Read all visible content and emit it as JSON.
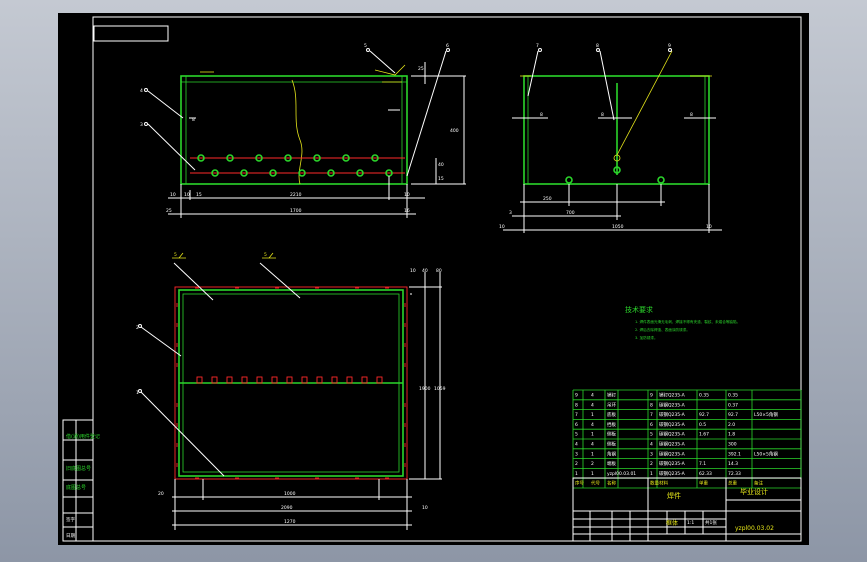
{
  "drawing": {
    "front_view": {
      "dims": {
        "d1": "10",
        "d2": "10",
        "d3": "15",
        "d4": "25",
        "d5": "2210",
        "d6": "1700",
        "d7": "10",
        "d8": "16",
        "d9": "40",
        "d10": "15",
        "d11": "25",
        "d12": "400",
        "d13": "8"
      },
      "balloons": [
        "4",
        "3",
        "5",
        "6"
      ]
    },
    "side_view": {
      "dims": {
        "a": "8",
        "b": "8",
        "c": "8",
        "d": "250",
        "e": "700",
        "f": "3",
        "g": "10",
        "h": "1050",
        "i": "10"
      },
      "balloons": [
        "7",
        "8",
        "9"
      ]
    },
    "top_view": {
      "dims": {
        "a": "20",
        "b": "1000",
        "c": "2090",
        "d": "1270",
        "e": "10",
        "f": "40",
        "g": "1900",
        "h": "1059",
        "i": "10",
        "j": "80"
      },
      "weld_marks": [
        "5",
        "5"
      ],
      "balloons": [
        "2",
        "1"
      ]
    },
    "tech_requirements": {
      "title": "技术要求",
      "lines": [
        "1. 焊件表面光滑无毛刺、焊接不得有夹渣、裂纹、未熔合等缺陷。",
        "2. 焊后去除焊渣、表面涂防锈漆。",
        "3. 加防锈漆。"
      ]
    },
    "parts_table": {
      "rows": [
        [
          "9",
          "4",
          "销钉",
          "9",
          "销钉Q235-A",
          "0.35",
          "0.35",
          ""
        ],
        [
          "8",
          "4",
          "吊环",
          "8",
          "碳钢Q235-A",
          "",
          "0.37",
          ""
        ],
        [
          "7",
          "1",
          "底板",
          "7",
          "碳钢Q235-A",
          "92.7",
          "92.7",
          "L50×5角钢"
        ],
        [
          "6",
          "4",
          "挡板",
          "6",
          "碳钢Q235-A",
          "0.5",
          "2.0",
          ""
        ],
        [
          "5",
          "1",
          "侧板",
          "5",
          "碳钢Q235-A",
          "1.67",
          "1.8",
          ""
        ],
        [
          "4",
          "4",
          "侧板",
          "4",
          "碳钢Q235-A",
          "",
          "300",
          ""
        ],
        [
          "3",
          "1",
          "角钢",
          "3",
          "碳钢Q235-A",
          "",
          "392.1",
          "L50×5角钢"
        ],
        [
          "2",
          "2",
          "端板",
          "2",
          "碳钢Q235-A",
          "7.1",
          "14.3",
          ""
        ],
        [
          "1",
          "1",
          "yzpl00.03.01",
          "1",
          "碳钢Q235-A",
          "62.33",
          "72.33",
          ""
        ]
      ],
      "header": [
        "序号",
        "代号",
        "名称",
        "数量",
        "材料",
        "单重",
        "总重",
        "备注"
      ],
      "title_cell": "焊件",
      "subtitle_cell": "框体",
      "design_cell": "毕业设计",
      "drawing_no": "yzpl00.03.02",
      "scale": "1:1",
      "sheet": "共1张"
    },
    "side_strip": [
      "借(通)用件登记",
      "旧底图总号",
      "底图总号",
      "签字",
      "日期"
    ],
    "corner_box": ""
  }
}
